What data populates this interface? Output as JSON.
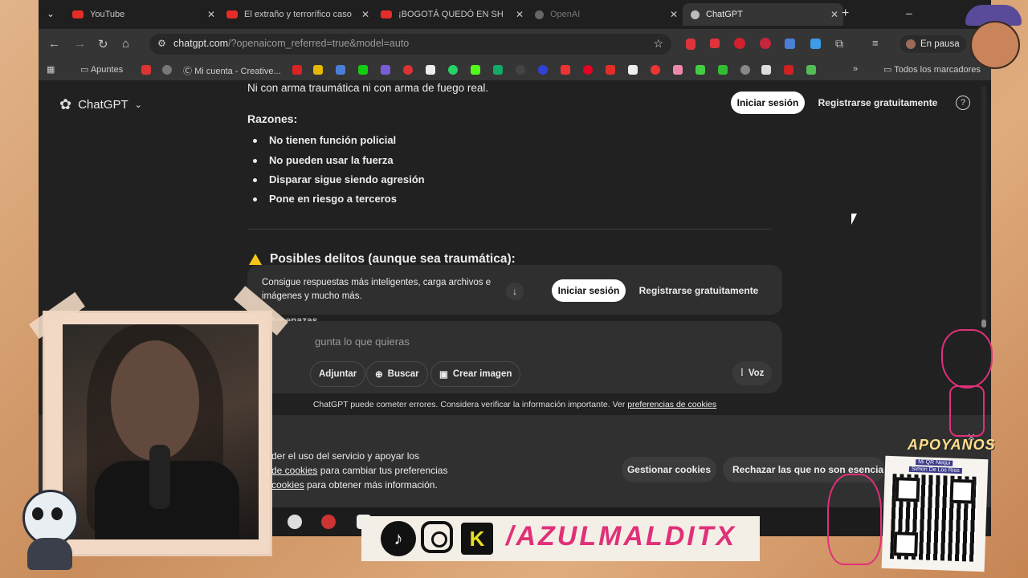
{
  "browser": {
    "tabs": [
      {
        "label": "YouTube",
        "icon": "youtube-icon"
      },
      {
        "label": "El extraño y terrorífico caso",
        "icon": "youtube-icon"
      },
      {
        "label": "¡BOGOTÁ QUEDÓ EN SH",
        "icon": "youtube-icon"
      },
      {
        "label": "OpenAI",
        "icon": "openai-icon"
      },
      {
        "label": "ChatGPT",
        "icon": "openai-icon"
      }
    ],
    "url_domain": "chatgpt.com",
    "url_path": "/?openaicom_referred=true&model=auto",
    "profile_label": "En pausa",
    "bookmarks": [
      "Apuntes",
      "Mi cuenta - Creative...",
      "Todos los marcadores"
    ]
  },
  "chatgpt": {
    "brand": "ChatGPT",
    "login_button": "Iniciar sesión",
    "register_button": "Registrarse gratuitamente",
    "top_line": "Ni con arma traumática ni con arma de fuego real.",
    "reasons_heading": "Razones:",
    "reasons": [
      "No tienen función policial",
      "No pueden usar la fuerza",
      "Disparar sigue siendo agresión",
      "Pone en riesgo a terceros"
    ],
    "crimes_heading": "Posibles delitos (aunque sea traumática):",
    "partial_item": "Amenazas",
    "promo_text": "Consigue respuestas más inteligentes, carga archivos e imágenes y mucho más.",
    "promo_login": "Iniciar sesión",
    "promo_register": "Registrarse gratuitamente",
    "composer_placeholder": "gunta lo que quieras",
    "attach": "Adjuntar",
    "search": "Buscar",
    "create_image": "Crear imagen",
    "voice": "Voz",
    "disclaimer": "ChatGPT puede cometer errores. Considera verificar la información importante. Ver",
    "disclaimer_link": "preferencias de cookies",
    "cookie_line1": "der el uso del servicio y apoyar los",
    "cookie_line2_link": "de cookies",
    "cookie_line2": "para cambiar tus preferencias",
    "cookie_line3_link": "cookies",
    "cookie_line3": "para obtener más información.",
    "manage_cookies": "Gestionar cookies",
    "reject_cookies": "Rechazar las que no son esencia"
  },
  "overlay": {
    "support_title": "APOYANOS",
    "qr_caption_1": "Mi QR Nequi",
    "qr_caption_2": "Simon De Los Rios",
    "channel_name": "/AZULMALDITX"
  },
  "colors": {
    "accent_pink": "#e0307a",
    "page_bg": "#212121",
    "frame": "#d9a274"
  }
}
